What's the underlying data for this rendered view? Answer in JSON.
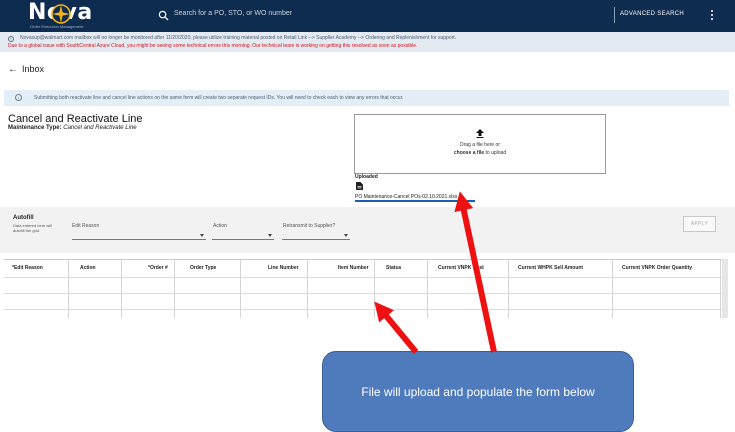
{
  "header": {
    "logo_text": "Nova",
    "logo_subtitle": "Order Execution Management",
    "search_placeholder": "Search for a PO, STO, or WO number",
    "advanced_search_label": "ADVANCED SEARCH",
    "brand_color": "#0d2c4f"
  },
  "notice": {
    "line1": "Novasup@walmart.com mailbox will no longer be monitored after 11/20/2020, please utilize training material posted on Retail Link --> Supplier Academy --> Ordering and Replenishment for support.",
    "line2": "Due to a global issue with SouthCentral Azure Cloud, you might be seeing some technical errors this morning. Our technical team is working on getting this resolved as soon as possible.",
    "alert_color": "#d0131b"
  },
  "page": {
    "back_icon": "arrow-left-icon",
    "back_glyph": "←",
    "title": "Inbox"
  },
  "info_banner": {
    "text": "Submitting both reactivate line and cancel line actions on the same form will create two separate request IDs. You will need to check each to view any errors that occur."
  },
  "form": {
    "title": "Cancel and Reactivate Line",
    "maintenance_label": "Maintenance Type:",
    "maintenance_value": "Cancel and Reactivate Line"
  },
  "upload": {
    "drag_text": "Drag a file here or",
    "choose_bold": "choose a file",
    "choose_rest": " to upload",
    "uploaded_label": "Uploaded",
    "file_name": "PO Maintenance-Cancel POs-02.10.2021.xlsx"
  },
  "autofill": {
    "title": "Autofill",
    "note": "Data entered here will autofill the grid.",
    "fields": [
      {
        "label": "Edit Reason"
      },
      {
        "label": "Action"
      },
      {
        "label": "Retransmit to Supplier?"
      }
    ],
    "apply_label": "APPLY"
  },
  "grid": {
    "columns": [
      "*Edit Reason",
      "Action",
      "*Order #",
      "Order Type",
      "Line Number",
      "Item Number",
      "Status",
      "Current VNPK Cost",
      "Current WHPK Sell Amount",
      "Current VNPK Order Quantity"
    ]
  },
  "callout": {
    "text": "File will upload and populate the form below",
    "color": "#4f7bbd"
  },
  "annotation": {
    "arrow_color": "#ee1111"
  }
}
